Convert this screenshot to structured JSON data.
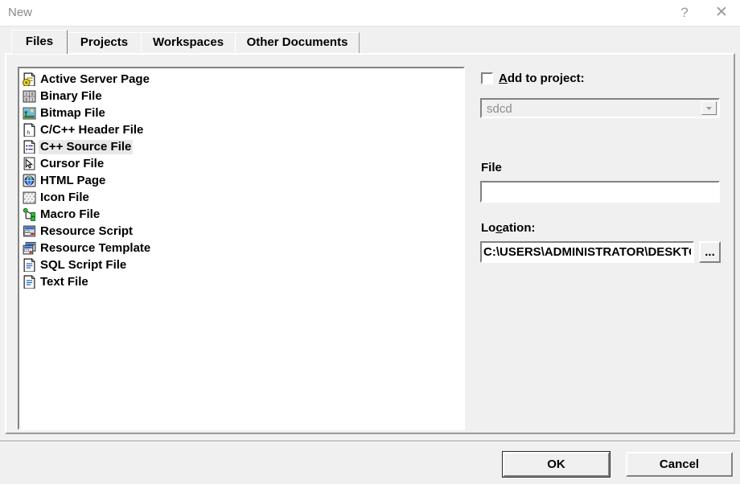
{
  "window": {
    "title": "New",
    "help_label": "?",
    "close_label": "✕"
  },
  "tabs": [
    {
      "label": "Files",
      "selected": true
    },
    {
      "label": "Projects",
      "selected": false
    },
    {
      "label": "Workspaces",
      "selected": false
    },
    {
      "label": "Other Documents",
      "selected": false
    }
  ],
  "file_list": {
    "selected_index": 4,
    "items": [
      {
        "label": "Active Server Page",
        "icon": "active-server-page-icon"
      },
      {
        "label": "Binary File",
        "icon": "binary-file-icon"
      },
      {
        "label": "Bitmap File",
        "icon": "bitmap-file-icon"
      },
      {
        "label": "C/C++ Header File",
        "icon": "header-file-icon"
      },
      {
        "label": "C++ Source File",
        "icon": "cpp-source-file-icon"
      },
      {
        "label": "Cursor File",
        "icon": "cursor-file-icon"
      },
      {
        "label": "HTML Page",
        "icon": "html-page-icon"
      },
      {
        "label": "Icon File",
        "icon": "icon-file-icon"
      },
      {
        "label": "Macro File",
        "icon": "macro-file-icon"
      },
      {
        "label": "Resource Script",
        "icon": "resource-script-icon"
      },
      {
        "label": "Resource Template",
        "icon": "resource-template-icon"
      },
      {
        "label": "SQL Script File",
        "icon": "sql-script-file-icon"
      },
      {
        "label": "Text File",
        "icon": "text-file-icon"
      }
    ]
  },
  "options": {
    "add_to_project": {
      "label_prefix": "",
      "label_accel": "A",
      "label_rest": "dd to project:",
      "checked": false
    },
    "project_combo": {
      "value": "sdcd",
      "disabled": true,
      "arrow_icon": "chevron-down-icon"
    },
    "file": {
      "label": "File",
      "value": "",
      "placeholder": ""
    },
    "location": {
      "label_prefix": "Lo",
      "label_accel": "c",
      "label_rest": "ation:",
      "value": "C:\\USERS\\ADMINISTRATOR\\DESKTOP",
      "browse_label": "..."
    }
  },
  "footer": {
    "ok_label": "OK",
    "cancel_label": "Cancel"
  },
  "colors": {
    "dialog_face": "#f0f0f0",
    "titlebar": "#ffffff",
    "title_text": "#8a8a8a",
    "shadow": "#828282",
    "highlight": "#ffffff",
    "selection": "#e8e8e8",
    "disabled_text": "#8c8c8c"
  }
}
